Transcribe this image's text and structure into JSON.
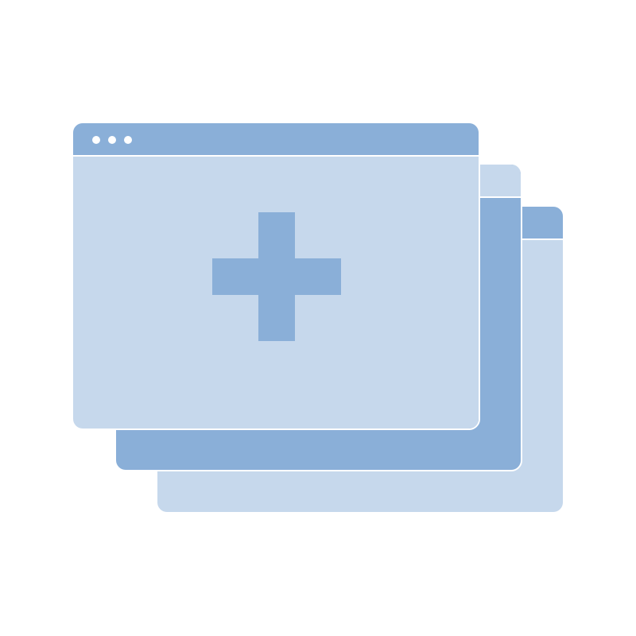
{
  "colors": {
    "background": "#ffffff",
    "window_light": "#c6d8ec",
    "window_dark": "#8aafd8",
    "dot": "#ffffff",
    "plus": "#8aafd8"
  },
  "icons": {
    "front_window": "browser-window-icon",
    "add": "plus-icon",
    "stack": "stacked-windows-icon"
  }
}
